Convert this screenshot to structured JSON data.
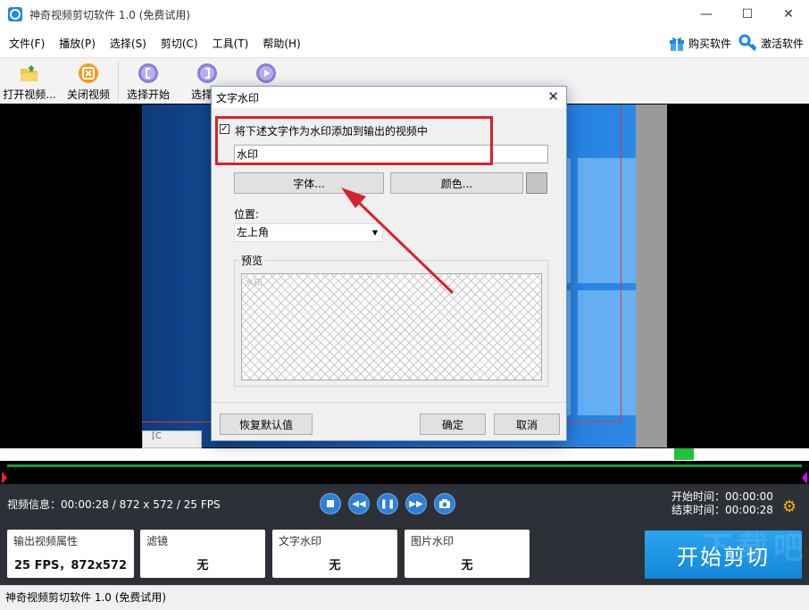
{
  "app": {
    "title": "神奇视频剪切软件 1.0 (免费试用)",
    "win_controls": [
      "—",
      "☐",
      "✕"
    ]
  },
  "menu": {
    "items": [
      "文件(F)",
      "播放(P)",
      "选择(S)",
      "剪切(C)",
      "工具(T)",
      "帮助(H)"
    ],
    "buy": "购买软件",
    "activate": "激活软件"
  },
  "toolbar": {
    "open": "打开视频...",
    "close": "关闭视频",
    "select_start": "选择开始",
    "select_end": "选择结"
  },
  "video": {
    "corner_label": "[C"
  },
  "info": {
    "video_info": "视频信息：00:00:28 / 872 x 572 / 25 FPS",
    "start_time_label": "开始时间：",
    "start_time": "00:00:00",
    "end_time_label": "结束时间：",
    "end_time": "00:00:28"
  },
  "cards": {
    "output_label": "输出视频属性",
    "output_value": "25 FPS，872x572",
    "filter_label": "滤镜",
    "filter_value": "无",
    "text_wm_label": "文字水印",
    "text_wm_value": "无",
    "img_wm_label": "图片水印",
    "img_wm_value": "无",
    "start_button": "开始剪切"
  },
  "status": {
    "text": "神奇视频剪切软件 1.0 (免费试用)"
  },
  "watermark_brand": "下载吧",
  "dialog": {
    "title": "文字水印",
    "checkbox_checked": true,
    "checkbox_label": "将下述文字作为水印添加到输出的视频中",
    "text_value": "水印",
    "font_button": "字体...",
    "color_button": "颜色...",
    "swatch_color": "#c4c4c4",
    "position_label": "位置:",
    "position_value": "左上角",
    "preview_label": "预览",
    "preview_text": "水印",
    "reset_button": "恢复默认值",
    "ok_button": "确定",
    "cancel_button": "取消"
  },
  "colors": {
    "annotation_red": "#d9222b",
    "accent_blue": "#1e88e5",
    "timeline_green": "#1a9e2e"
  }
}
